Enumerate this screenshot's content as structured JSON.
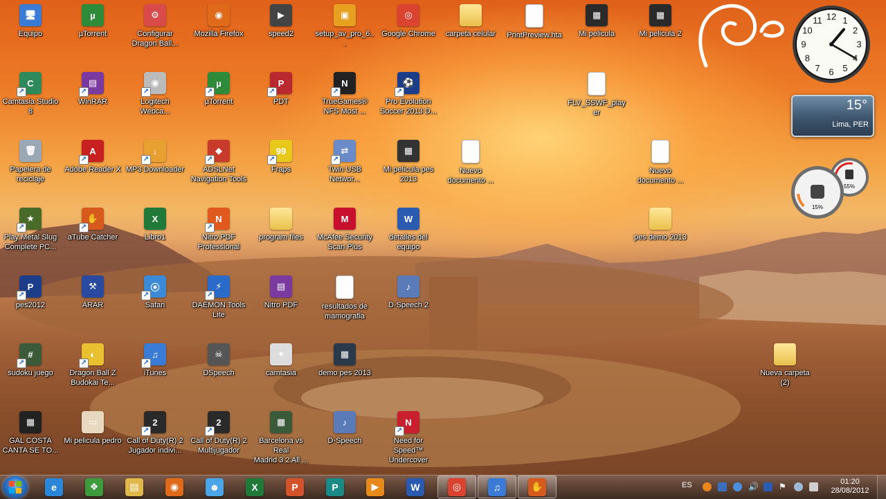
{
  "desktop_icons": [
    {
      "label": "Equipo"
    },
    {
      "label": "µTorrent"
    },
    {
      "label": "Configurar\nDragon Ball..."
    },
    {
      "label": "Mozilla Firefox"
    },
    {
      "label": "speed2"
    },
    {
      "label": "setup_av_pro_6..."
    },
    {
      "label": "Google Chrome"
    },
    {
      "label": "carpeta celular"
    },
    {
      "label": "PrintPreview.hta"
    },
    {
      "label": "Mi pelicula"
    },
    {
      "label": "Mi pelicula 2"
    },
    {
      "label": "Camtasia Studio\n8"
    },
    {
      "label": "WinRAR"
    },
    {
      "label": "Logitech\nWebca..."
    },
    {
      "label": "µTorrent"
    },
    {
      "label": "PDT"
    },
    {
      "label": "TrueGames®\nNFS Most ..."
    },
    {
      "label": "Pro Evolution\nSoccer 2013 D..."
    },
    {
      "label": "FLV_SSWF_player"
    },
    {
      "label": "Papelera de\nreciclaje"
    },
    {
      "label": "Adobe Reader X"
    },
    {
      "label": "MP3 Downloader"
    },
    {
      "label": "ADSLNet\nNavigation Tools"
    },
    {
      "label": "Fraps"
    },
    {
      "label": "Twin USB\nNetwor..."
    },
    {
      "label": "Mi pelicula pes\n2013"
    },
    {
      "label": "Nuevo\ndocumento ..."
    },
    {
      "label": "Nuevo\ndocumento ..."
    },
    {
      "label": "Play Metal Slug\nComplete PC..."
    },
    {
      "label": "aTube Catcher"
    },
    {
      "label": "Libro1"
    },
    {
      "label": "Nitro PDF\nProfessional"
    },
    {
      "label": "program files"
    },
    {
      "label": "McAfee Security\nScan Plus"
    },
    {
      "label": "detalles del\nequipo"
    },
    {
      "label": "pes demo 2013"
    },
    {
      "label": "pes2012"
    },
    {
      "label": "ARAR"
    },
    {
      "label": "Safari"
    },
    {
      "label": "DAEMON Tools\nLite"
    },
    {
      "label": "Nitro PDF"
    },
    {
      "label": "resultados de\nmamografia"
    },
    {
      "label": "D-Speech 2"
    },
    {
      "label": "sudoku juego"
    },
    {
      "label": "Dragon Ball Z\nBudokai Te..."
    },
    {
      "label": "iTunes"
    },
    {
      "label": "DSpeech"
    },
    {
      "label": "camtasia"
    },
    {
      "label": "demo pes 2013"
    },
    {
      "label": "Nueva carpeta (2)"
    },
    {
      "label": "GAL COSTA\nCANTA SE TO..."
    },
    {
      "label": "Mi pelicula pedro"
    },
    {
      "label": "Call of Duty(R) 2\nJugador indivi..."
    },
    {
      "label": "Call of Duty(R) 2\nMultijugador"
    },
    {
      "label": "Barcelona vs Real\nMadrid 3 2 All ..."
    },
    {
      "label": "D-Speech"
    },
    {
      "label": "Need for Speed™\nUndercover"
    }
  ],
  "clock": {
    "numbers": [
      "12",
      "1",
      "2",
      "3",
      "4",
      "5",
      "6",
      "7",
      "8",
      "9",
      "10",
      "11"
    ],
    "hour": 1,
    "minute": 20
  },
  "weather": {
    "temperature": "15°",
    "city": "Lima, PER"
  },
  "meter": {
    "cpu": "15%",
    "memory": "55%",
    "cpu_level": 0.15,
    "memory_level": 0.55
  },
  "taskbar": {
    "pinned": [
      {
        "name": "internet-explorer",
        "color": "#2a86d8",
        "glyph": "e"
      },
      {
        "name": "media-center",
        "color": "#3d9a3d",
        "glyph": "❖"
      },
      {
        "name": "explorer",
        "color": "#e0b84a",
        "glyph": "▤"
      },
      {
        "name": "firefox",
        "color": "#e06a1a",
        "glyph": "◉"
      },
      {
        "name": "messenger",
        "color": "#4aa6e8",
        "glyph": "☻"
      },
      {
        "name": "excel",
        "color": "#1f7a3a",
        "glyph": "X"
      },
      {
        "name": "powerpoint",
        "color": "#d2522a",
        "glyph": "P"
      },
      {
        "name": "publisher",
        "color": "#1a8a86",
        "glyph": "P"
      },
      {
        "name": "media-player",
        "color": "#e88a1a",
        "glyph": "▶"
      },
      {
        "name": "word",
        "color": "#2a5bb0",
        "glyph": "W"
      },
      {
        "name": "chrome",
        "color": "#d9432f",
        "glyph": "◎"
      },
      {
        "name": "itunes",
        "color": "#3a7bd5",
        "glyph": "♫"
      },
      {
        "name": "atube-catcher",
        "color": "#d65a1e",
        "glyph": "✋"
      }
    ],
    "language": "ES",
    "time": "01:20",
    "date": "28/08/2012"
  }
}
